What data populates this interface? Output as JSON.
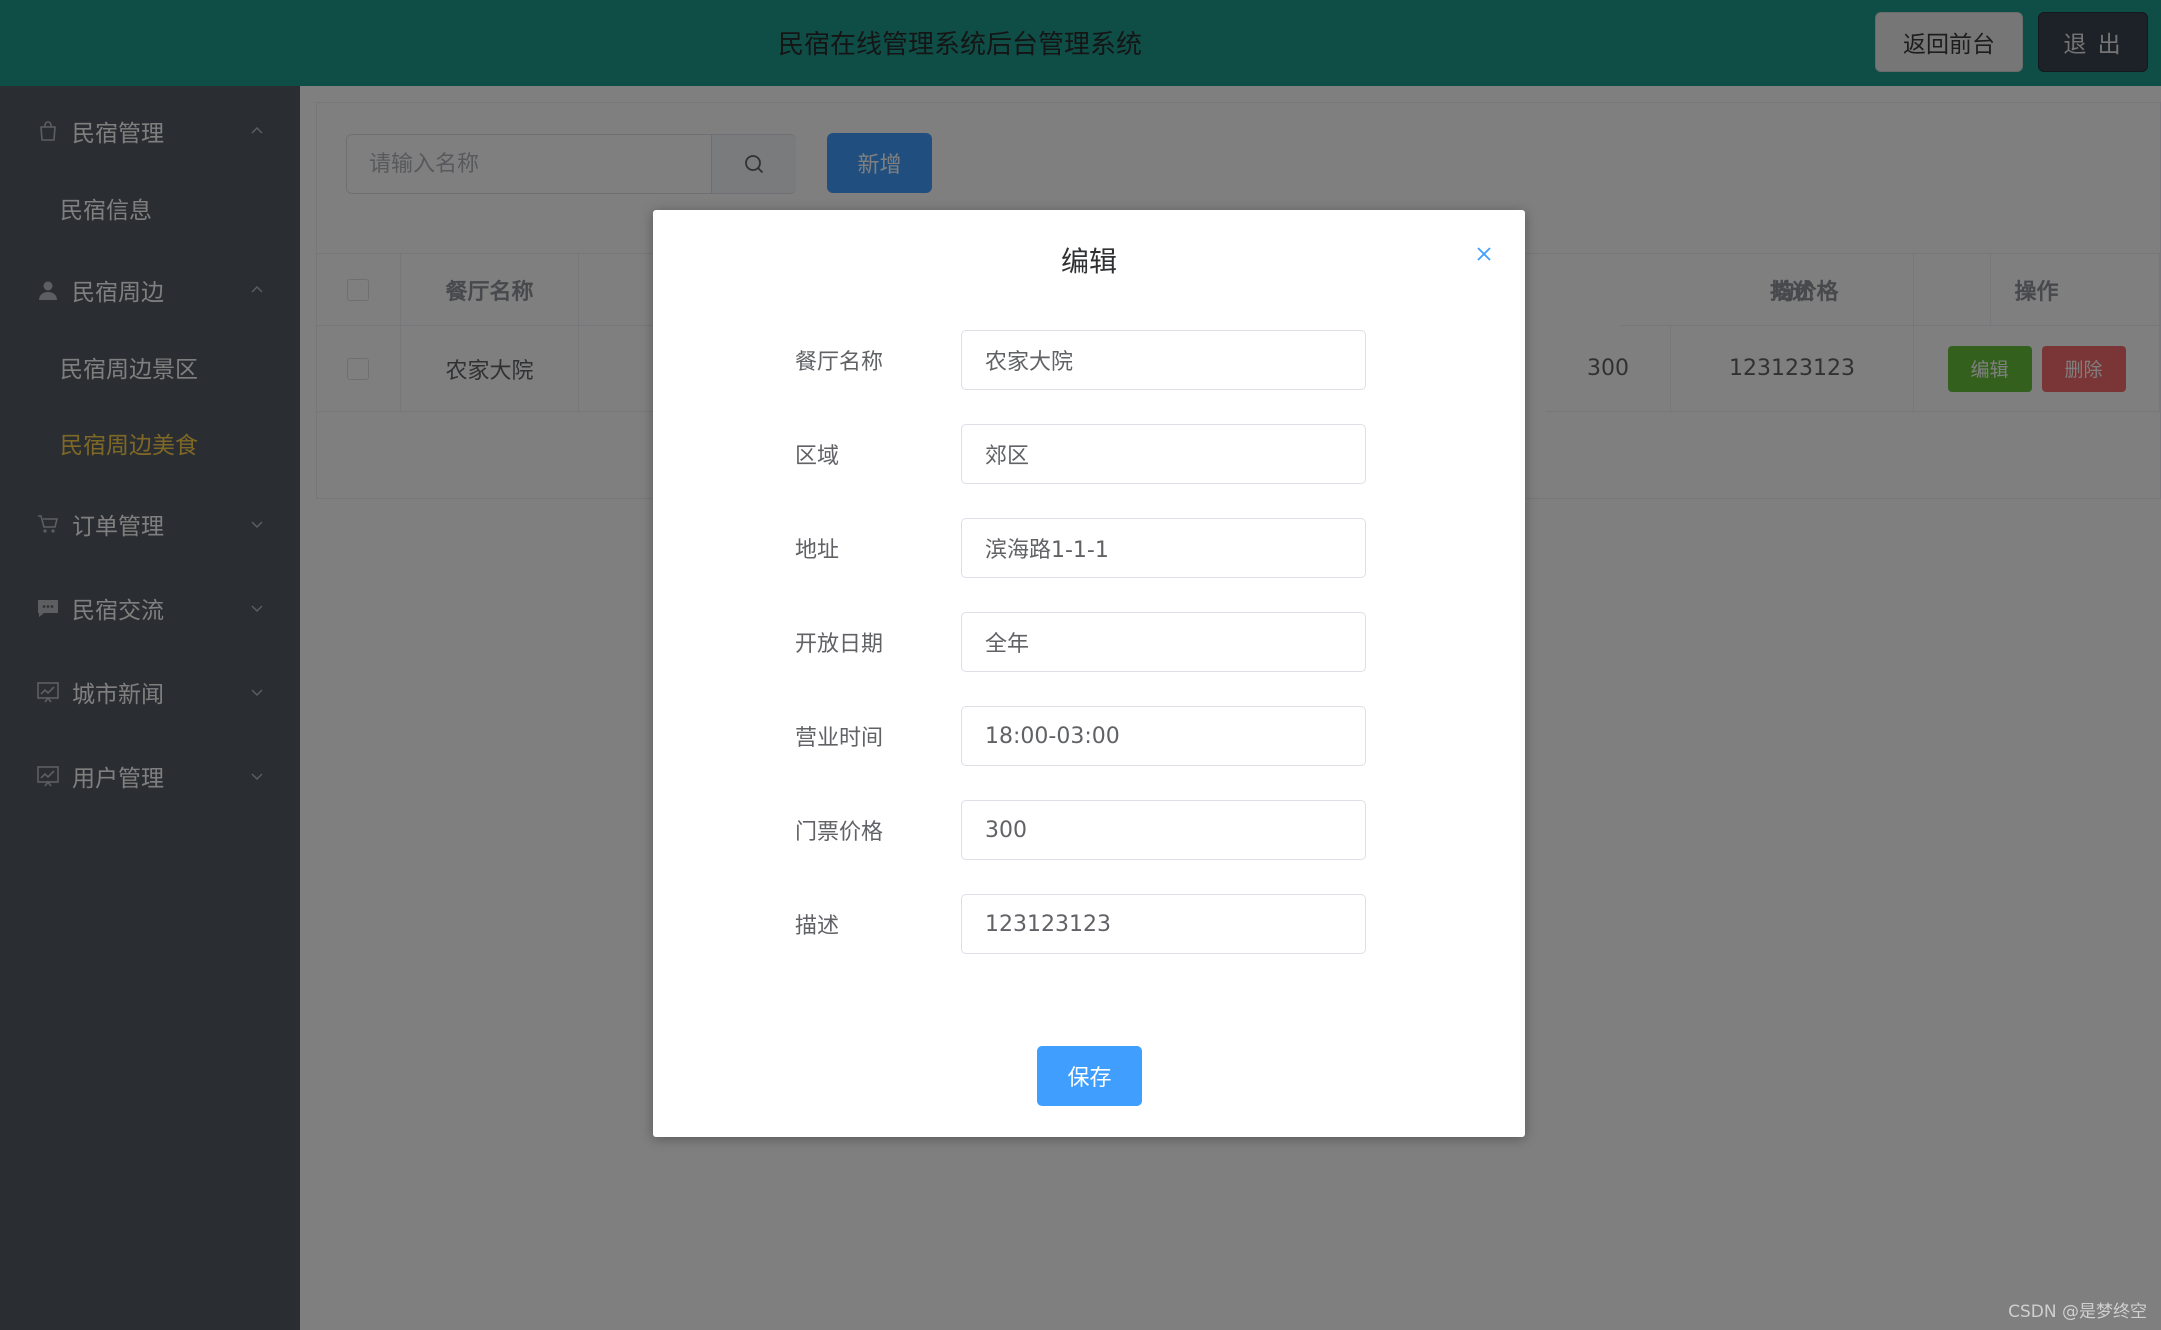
{
  "header": {
    "title": "民宿在线管理系统后台管理系统",
    "front_button": "返回前台",
    "logout_button": "退 出"
  },
  "sidebar": {
    "groups": [
      {
        "label": "民宿管理",
        "icon": "bag-icon",
        "expanded": true,
        "children": [
          "民宿信息"
        ]
      },
      {
        "label": "民宿周边",
        "icon": "user-icon",
        "expanded": true,
        "children": [
          "民宿周边景区",
          "民宿周边美食"
        ]
      },
      {
        "label": "订单管理",
        "icon": "cart-icon",
        "expanded": false
      },
      {
        "label": "民宿交流",
        "icon": "chat-icon",
        "expanded": false
      },
      {
        "label": "城市新闻",
        "icon": "chart-icon",
        "expanded": false
      },
      {
        "label": "用户管理",
        "icon": "chart-icon",
        "expanded": false
      }
    ],
    "active_item": "民宿周边美食",
    "active_color": "#ffd04b"
  },
  "toolbar": {
    "search_placeholder": "请输入名称",
    "add_button": "新增"
  },
  "table": {
    "headers": {
      "name": "餐厅名称",
      "price": "均价格",
      "desc": "描述",
      "ops": "操作"
    },
    "rows": [
      {
        "name": "农家大院",
        "price": "300",
        "desc": "123123123"
      }
    ],
    "edit_label": "编辑",
    "delete_label": "删除"
  },
  "dialog": {
    "title": "编辑",
    "fields": [
      {
        "label": "餐厅名称",
        "value": "农家大院"
      },
      {
        "label": "区域",
        "value": "郊区"
      },
      {
        "label": "地址",
        "value": "滨海路1-1-1"
      },
      {
        "label": "开放日期",
        "value": "全年"
      },
      {
        "label": "营业时间",
        "value": "18:00-03:00"
      },
      {
        "label": "门票价格",
        "value": "300"
      },
      {
        "label": "描述",
        "value": "123123123"
      }
    ],
    "save_button": "保存"
  },
  "watermark": "CSDN @是梦终空",
  "colors": {
    "header_bg": "#1f9d8f",
    "sidebar_bg": "#545c64",
    "primary": "#409eff",
    "success": "#67c23a",
    "danger": "#f56c6c"
  }
}
